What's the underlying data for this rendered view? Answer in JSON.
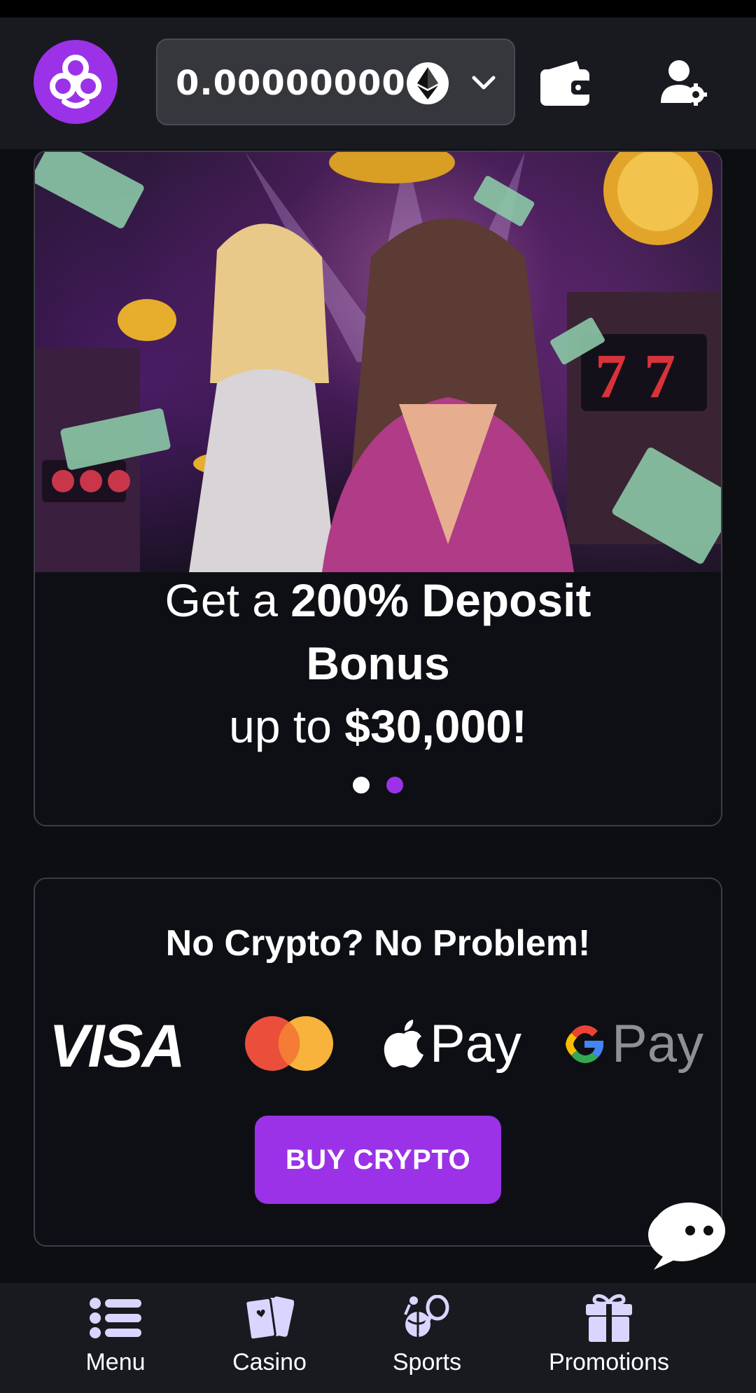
{
  "header": {
    "balance": "0.00000000",
    "currency_icon": "ethereum-icon"
  },
  "banner": {
    "line1_regular": "Get a ",
    "line1_bold": "200% Deposit",
    "line2_bold": "Bonus",
    "line3_regular": "up to ",
    "line3_bold": "$30,000!",
    "slides": 2,
    "active_slide": 2
  },
  "buy_crypto": {
    "title": "No Crypto? No Problem!",
    "visa_label": "VISA",
    "apple_pay_label": "Pay",
    "google_pay_label": "Pay",
    "button_label": "BUY CRYPTO"
  },
  "bottom_nav": {
    "items": [
      {
        "label": "Menu",
        "icon": "menu-list-icon"
      },
      {
        "label": "Casino",
        "icon": "cards-icon"
      },
      {
        "label": "Sports",
        "icon": "sports-icon"
      },
      {
        "label": "Promotions",
        "icon": "gift-icon"
      }
    ]
  },
  "colors": {
    "accent": "#9b32e8",
    "background": "#0d0e12",
    "header_bg": "#191a1f",
    "dot_inactive": "#ffffff"
  }
}
